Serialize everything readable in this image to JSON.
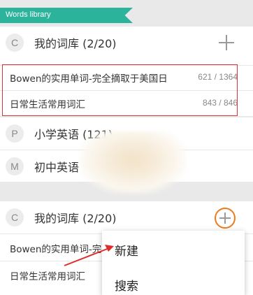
{
  "header": {
    "title": "Words library"
  },
  "groups": [
    {
      "badge": "C",
      "label": "我的词库 (2/20)",
      "books": [
        {
          "title": "Bowen的实用单词-完全摘取于美国日",
          "count": "621 / 1364"
        },
        {
          "title": "日常生活常用词汇",
          "count": "843 / 846"
        }
      ]
    },
    {
      "badge": "P",
      "label": "小学英语 (121)"
    },
    {
      "badge": "M",
      "label": "初中英语"
    }
  ],
  "second_panel": {
    "badge": "C",
    "label": "我的词库 (2/20)",
    "books": [
      {
        "title": "Bowen的实用单词-完"
      },
      {
        "title": "日常生活常用词汇"
      }
    ]
  },
  "popup_menu": {
    "items": [
      "新建",
      "搜索"
    ]
  },
  "colors": {
    "ribbon": "#2bb39b",
    "highlight": "#d8323a",
    "plus_circle": "#f07a1a",
    "arrow": "#e02b2b"
  }
}
